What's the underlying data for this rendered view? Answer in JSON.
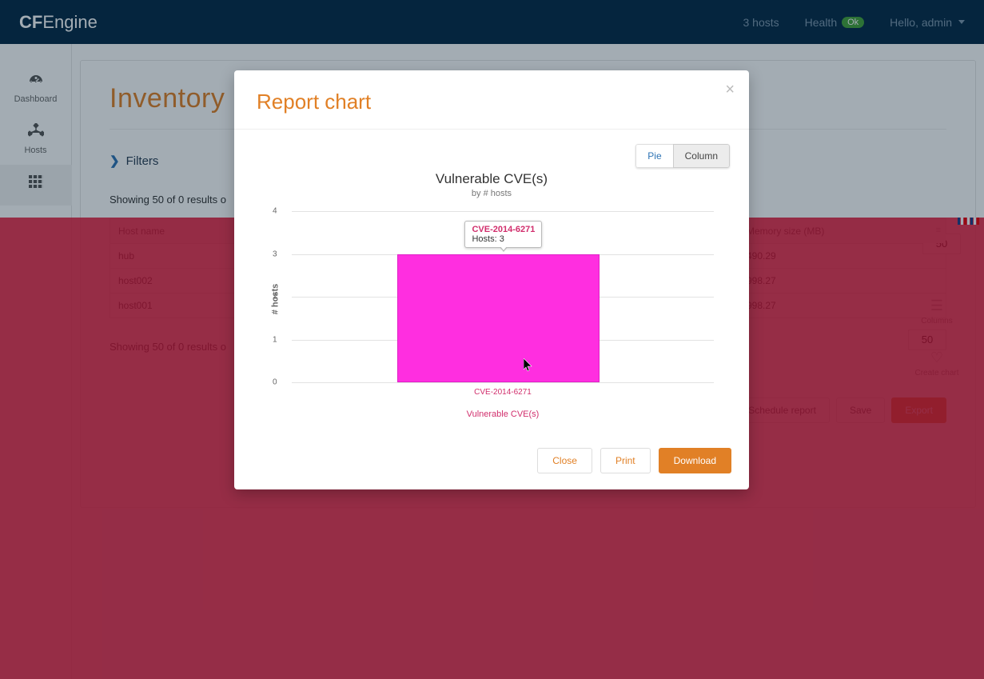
{
  "brand": {
    "a": "CF",
    "b": "Engine"
  },
  "topnav": {
    "hosts": "3 hosts",
    "health_label": "Health",
    "health_status": "Ok",
    "greeting": "Hello, admin"
  },
  "sidebar": {
    "items": [
      {
        "label": "Dashboard"
      },
      {
        "label": "Hosts"
      },
      {
        "label": ""
      }
    ]
  },
  "page": {
    "title": "Inventory",
    "filters_label": "Filters",
    "results_line_top": "Showing 50 of 0 results o",
    "page_size_top": "50",
    "results_line_bottom": "Showing 50 of 0 results o",
    "page_size_bottom": "50",
    "table": {
      "headers": [
        "Host name",
        "Memory size (MB)"
      ],
      "rows": [
        {
          "host": "hub",
          "mem": "490.29"
        },
        {
          "host": "host002",
          "mem": "998.27"
        },
        {
          "host": "host001",
          "mem": "998.27"
        }
      ]
    },
    "side_actions": {
      "columns": "Columns",
      "create_chart": "Create chart"
    },
    "actions": {
      "schedule": "Schedule report",
      "save": "Save",
      "export": "Export"
    }
  },
  "modal": {
    "title": "Report chart",
    "toggle": {
      "pie": "Pie",
      "column": "Column"
    },
    "chart_title": "Vulnerable CVE(s)",
    "chart_subtitle": "by # hosts",
    "y_axis_label": "# hosts",
    "x_axis_label": "Vulnerable CVE(s)",
    "tooltip": {
      "line1": "CVE-2014-6271",
      "line2": "Hosts: 3"
    },
    "buttons": {
      "close": "Close",
      "print": "Print",
      "download": "Download"
    }
  },
  "chart_data": {
    "type": "bar",
    "categories": [
      "CVE-2014-6271"
    ],
    "values": [
      3
    ],
    "y_ticks": [
      0,
      1,
      2,
      3,
      4
    ],
    "title": "Vulnerable CVE(s)",
    "subtitle": "by # hosts",
    "xlabel": "Vulnerable CVE(s)",
    "ylabel": "# hosts",
    "ylim": [
      0,
      4
    ]
  }
}
